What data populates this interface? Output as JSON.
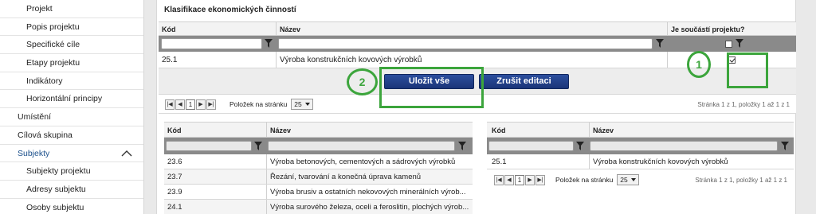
{
  "sidebar": {
    "items": [
      {
        "label": "Projekt"
      },
      {
        "label": "Popis projektu"
      },
      {
        "label": "Specifické cíle"
      },
      {
        "label": "Etapy projektu"
      },
      {
        "label": "Indikátory"
      },
      {
        "label": "Horizontální principy"
      },
      {
        "label": "Umístění"
      },
      {
        "label": "Cílová skupina"
      },
      {
        "label": "Subjekty"
      },
      {
        "label": "Subjekty projektu"
      },
      {
        "label": "Adresy subjektu"
      },
      {
        "label": "Osoby subjektu"
      }
    ]
  },
  "panel": {
    "title": "Klasifikace ekonomických činností"
  },
  "top_grid": {
    "col_code": "Kód",
    "col_name": "Název",
    "col_part": "Je součástí projektu?",
    "row": {
      "code": "25.1",
      "name": "Výroba konstrukčních kovových výrobků",
      "checked": true
    },
    "save_all": "Uložit vše",
    "cancel_edit": "Zrušit editaci",
    "pager": {
      "current_page": "1",
      "page_size_label": "Položek na stránku",
      "page_size": "25",
      "info": "Stránka 1 z 1, položky 1 až 1 z 1"
    }
  },
  "annotations": {
    "one": "1",
    "two": "2",
    "color": "#3ca53c"
  },
  "left_grid": {
    "col_code": "Kód",
    "col_name": "Název",
    "rows": [
      {
        "code": "23.6",
        "name": "Výroba betonových, cementových a sádrových výrobků"
      },
      {
        "code": "23.7",
        "name": "Řezání, tvarování a konečná úprava kamenů"
      },
      {
        "code": "23.9",
        "name": "Výroba brusiv a ostatních nekovových minerálních výrob..."
      },
      {
        "code": "24.1",
        "name": "Výroba surového železa, oceli a feroslitin, plochých výrob..."
      }
    ]
  },
  "right_grid": {
    "col_code": "Kód",
    "col_name": "Název",
    "rows": [
      {
        "code": "25.1",
        "name": "Výroba konstrukčních kovových výrobků"
      }
    ],
    "pager": {
      "current_page": "1",
      "page_size_label": "Položek na stránku",
      "page_size": "25",
      "info": "Stránka 1 z 1, položky 1 až 1 z 1"
    }
  }
}
